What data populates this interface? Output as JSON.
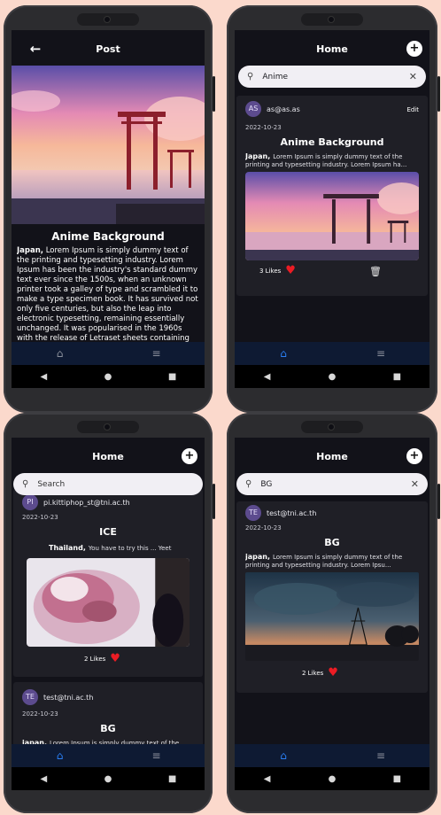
{
  "screens": {
    "post": {
      "title": "Post",
      "heading": "Anime Background",
      "location": "Japan,",
      "body": "Lorem Ipsum is simply dummy text of the printing and typesetting industry. Lorem Ipsum has been the industry's standard dummy text ever since the 1500s, when an unknown printer took a galley of type and scrambled it to make a type specimen book. It has survived not only five centuries, but also the leap into electronic typesetting, remaining essentially unchanged. It was popularised in the 1960s with the release of Letraset sheets containing Lorem Ipsum passages, and more recently with desktop publishing software like"
    },
    "home_search_anime": {
      "title": "Home",
      "search_value": "Anime",
      "post": {
        "avatar": "AS",
        "email": "as@as.as",
        "edit_label": "Edit",
        "date": "2022-10-23",
        "title": "Anime Background",
        "location": "Japan,",
        "excerpt": "Lorem Ipsum is simply dummy text of the printing and typesetting industry. Lorem Ipsum ha...",
        "likes": "3  Likes"
      }
    },
    "home_feed": {
      "title": "Home",
      "search_placeholder": "Search",
      "posts": [
        {
          "avatar": "PI",
          "email": "pi.kittiphop_st@tni.ac.th",
          "date": "2022-10-23",
          "title": "ICE",
          "location": "Thailand,",
          "excerpt": "You have to try this ... Yeet",
          "likes": "2  Likes"
        },
        {
          "avatar": "TE",
          "email": "test@tni.ac.th",
          "date": "2022-10-23",
          "title": "BG",
          "location": "japan,",
          "excerpt": "Lorem Ipsum is simply dummy text of the printing and typesetting industry. Lorem Ipsu..."
        }
      ]
    },
    "home_search_bg": {
      "title": "Home",
      "search_value": "BG",
      "post": {
        "avatar": "TE",
        "email": "test@tni.ac.th",
        "date": "2022-10-23",
        "title": "BG",
        "location": "japan,",
        "excerpt": "Lorem Ipsum is simply dummy text of the printing and typesetting industry. Lorem Ipsu...",
        "likes": "2  Likes"
      }
    }
  },
  "icons": {
    "back": "←",
    "add": "+",
    "search": "⚲",
    "clear": "✕",
    "home": "⌂",
    "menu": "≡",
    "heart": "♥",
    "trash": "🗑",
    "sys_back": "◀",
    "sys_home": "●",
    "sys_recent": "■"
  },
  "colors": {
    "accent": "#2a7ff5",
    "heart": "#ec1c24",
    "background": "#fbd9cc"
  }
}
